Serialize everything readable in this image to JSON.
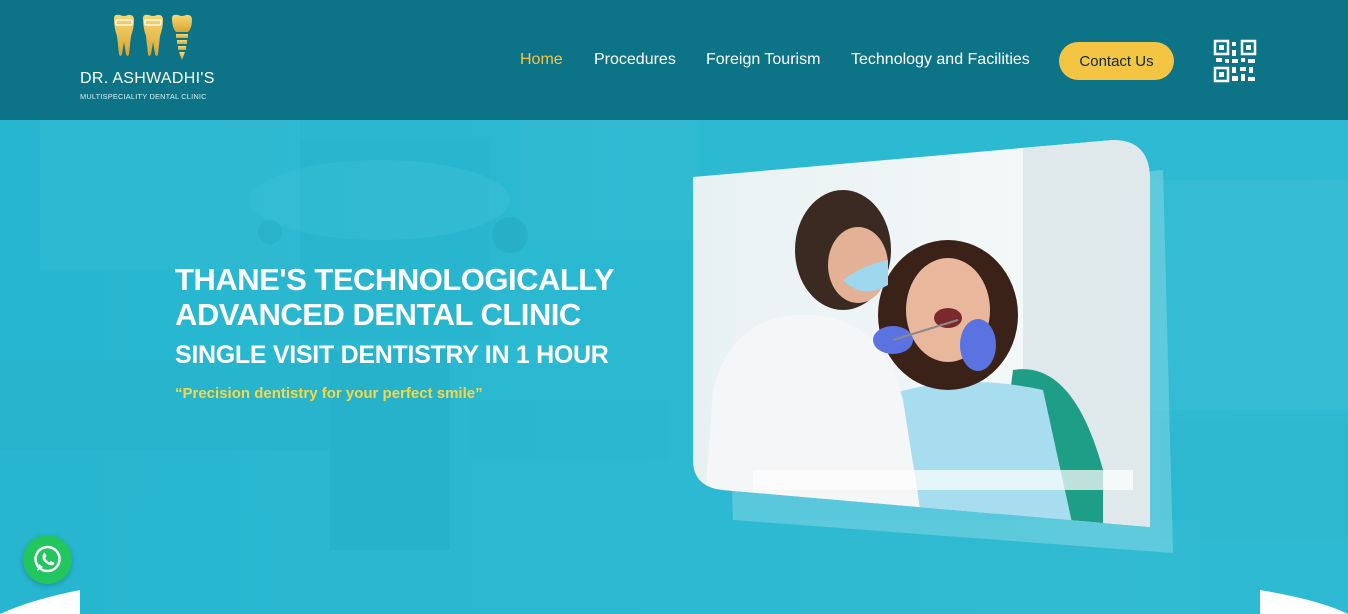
{
  "logo": {
    "name": "DR. ASHWADHI'S",
    "subtitle": "MULTISPECIALITY DENTAL CLINIC",
    "icon": "teeth-logo-icon"
  },
  "nav": {
    "items": [
      {
        "label": "Home",
        "active": true
      },
      {
        "label": "Procedures",
        "active": false
      },
      {
        "label": "Foreign Tourism",
        "active": false
      },
      {
        "label": "Technology and Facilities",
        "active": false
      }
    ],
    "contact_label": "Contact Us",
    "qr_icon": "qr-code-icon"
  },
  "hero": {
    "headline_line1": "THANE'S TECHNOLOGICALLY",
    "headline_line2": "ADVANCED DENTAL CLINIC",
    "subheadline": "SINGLE VISIT DENTISTRY IN 1 HOUR",
    "tagline": "“Precision dentistry for your perfect smile”",
    "photo": "dentist-examining-patient-image"
  },
  "floating": {
    "whatsapp_icon": "whatsapp-icon"
  },
  "colors": {
    "header_bg": "#0d7487",
    "hero_bg": "#2bb7cf",
    "accent": "#f4c542",
    "tagline": "#f4d84a",
    "whatsapp": "#22c55e"
  }
}
